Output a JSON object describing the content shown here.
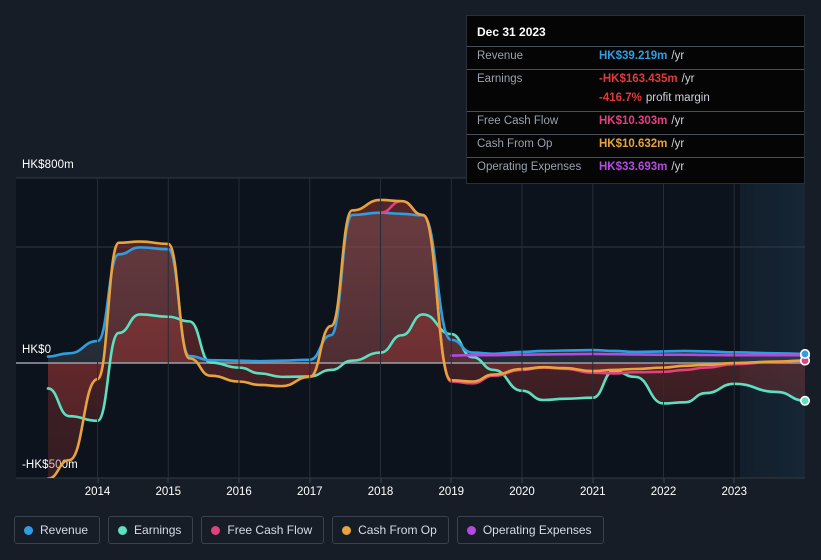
{
  "tooltip": {
    "date": "Dec 31 2023",
    "rows": [
      {
        "name": "Revenue",
        "value": "HK$39.219m",
        "unit": "/yr",
        "color": "#2f9ee0"
      },
      {
        "name": "Earnings",
        "value": "-HK$163.435m",
        "unit": "/yr",
        "color": "#e03a3a"
      },
      {
        "name": "Free Cash Flow",
        "value": "HK$10.303m",
        "unit": "/yr",
        "color": "#e0417f"
      },
      {
        "name": "Cash From Op",
        "value": "HK$10.632m",
        "unit": "/yr",
        "color": "#e8a33d"
      },
      {
        "name": "Operating Expenses",
        "value": "HK$33.693m",
        "unit": "/yr",
        "color": "#b44ae0"
      }
    ],
    "profit_margin": {
      "value": "-416.7%",
      "label": "profit margin",
      "color": "#e03a3a"
    }
  },
  "legend": {
    "items": [
      {
        "label": "Revenue",
        "color": "#2f9ee0"
      },
      {
        "label": "Earnings",
        "color": "#5ce0c0"
      },
      {
        "label": "Free Cash Flow",
        "color": "#e0417f"
      },
      {
        "label": "Cash From Op",
        "color": "#e8a33d"
      },
      {
        "label": "Operating Expenses",
        "color": "#b44ae0"
      }
    ]
  },
  "axes": {
    "y_labels": [
      "HK$800m",
      "HK$0",
      "-HK$500m"
    ],
    "x_labels": [
      "2014",
      "2015",
      "2016",
      "2017",
      "2018",
      "2019",
      "2020",
      "2021",
      "2022",
      "2023"
    ]
  },
  "chart_data": {
    "type": "line",
    "title": "",
    "xlabel": "",
    "ylabel": "HK$ (millions)",
    "ylim": [
      -500,
      800
    ],
    "grid": true,
    "legend_position": "bottom",
    "currency": "HKD",
    "units": "millions per year",
    "x": [
      2013.3,
      2013.6,
      2014.0,
      2014.3,
      2014.6,
      2015.0,
      2015.3,
      2015.6,
      2016.0,
      2016.3,
      2016.6,
      2017.0,
      2017.3,
      2017.6,
      2018.0,
      2018.3,
      2018.6,
      2019.0,
      2019.3,
      2019.6,
      2020.0,
      2020.3,
      2020.6,
      2021.0,
      2021.3,
      2021.6,
      2022.0,
      2022.3,
      2022.6,
      2023.0,
      2023.6,
      2024.0
    ],
    "series": [
      {
        "name": "Revenue",
        "color": "#2f9ee0",
        "values": [
          28,
          42,
          95,
          470,
          500,
          492,
          30,
          12,
          10,
          8,
          10,
          14,
          120,
          640,
          650,
          645,
          638,
          100,
          45,
          40,
          48,
          52,
          54,
          56,
          52,
          48,
          50,
          52,
          50,
          46,
          42,
          39.219
        ]
      },
      {
        "name": "Earnings",
        "color": "#5ce0c0",
        "values": [
          -110,
          -230,
          -250,
          130,
          210,
          200,
          180,
          2,
          -20,
          -45,
          -60,
          -58,
          -30,
          10,
          45,
          120,
          210,
          125,
          25,
          -30,
          -120,
          -160,
          -155,
          -150,
          -35,
          -60,
          -175,
          -170,
          -130,
          -90,
          -125,
          -163.435
        ]
      },
      {
        "name": "Free Cash Flow",
        "color": "#e0417f",
        "values": [
          null,
          null,
          null,
          null,
          null,
          null,
          null,
          null,
          null,
          null,
          null,
          null,
          null,
          null,
          650,
          700,
          640,
          -80,
          -88,
          -55,
          -30,
          -20,
          -25,
          -42,
          -45,
          -40,
          -38,
          -30,
          -20,
          -5,
          5,
          10.303
        ]
      },
      {
        "name": "Cash From Op",
        "color": "#e8a33d",
        "values": [
          -500,
          -420,
          -70,
          520,
          525,
          515,
          20,
          -55,
          -80,
          -95,
          -100,
          -60,
          160,
          660,
          705,
          700,
          640,
          -75,
          -80,
          -50,
          -26,
          -18,
          -22,
          -35,
          -30,
          -26,
          -20,
          -12,
          -8,
          0,
          6,
          10.632
        ]
      },
      {
        "name": "Operating Expenses",
        "color": "#b44ae0",
        "values": [
          null,
          null,
          null,
          null,
          null,
          null,
          null,
          null,
          null,
          null,
          null,
          null,
          null,
          null,
          null,
          null,
          null,
          32,
          34,
          34,
          36,
          37,
          38,
          39,
          38,
          37,
          36,
          36,
          35,
          34,
          34,
          33.693
        ]
      }
    ],
    "highlight_point": {
      "x": 2024.0,
      "label": "Dec 31 2023"
    }
  }
}
